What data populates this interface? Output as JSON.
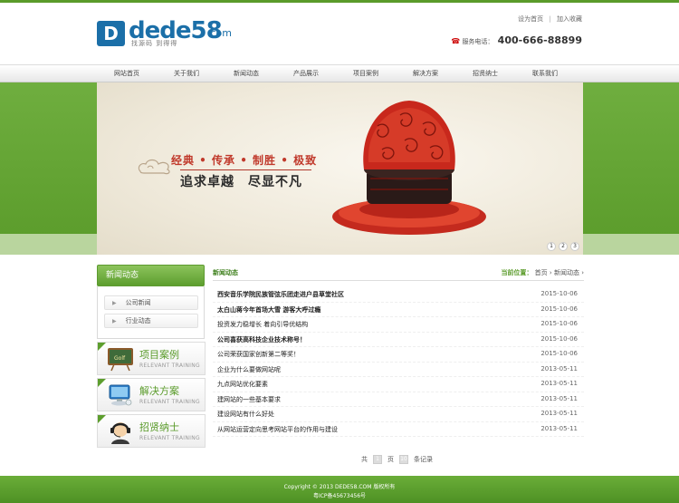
{
  "header": {
    "logo_mark": "D",
    "logo_text": "dede58",
    "logo_com": ".com",
    "logo_sub": "找源码 到得得",
    "links": [
      "设为首页",
      "加入收藏"
    ],
    "hotline_label": "服务电话：",
    "hotline_number": "400-666-88899"
  },
  "nav": [
    "网站首页",
    "关于我们",
    "新闻动态",
    "产品展示",
    "项目案例",
    "解决方案",
    "招贤纳士",
    "联系我们"
  ],
  "banner": {
    "slogan1": "经典 • 传承 • 制胜 • 极致",
    "slogan2": "追求卓越　尽显不凡",
    "dots": [
      "1",
      "2",
      "3"
    ]
  },
  "sidebar": {
    "title": "新闻动态",
    "links": [
      "公司新闻",
      "行业动态"
    ],
    "promos": [
      {
        "title": "项目案例",
        "sub": "RELEVANT TRAINING",
        "icon": "chalkboard-icon"
      },
      {
        "title": "解决方案",
        "sub": "RELEVANT TRAINING",
        "icon": "computer-icon"
      },
      {
        "title": "招贤纳士",
        "sub": "RELEVANT TRAINING",
        "icon": "support-agent-icon"
      }
    ]
  },
  "main": {
    "title": "新闻动态",
    "crumb_label": "当前位置：",
    "crumb_home": "首页",
    "crumb_current": "新闻动态",
    "news": [
      {
        "title": "西安音乐学院民族管弦乐团走进户县草堂社区",
        "date": "2015-10-06",
        "bold": true
      },
      {
        "title": "太白山蒋今年首场大雪 游客大呼过瘾",
        "date": "2015-10-06",
        "bold": true
      },
      {
        "title": "投资发力稳增长 着向引导优结构",
        "date": "2015-10-06",
        "bold": false
      },
      {
        "title": "公司喜获高科技企业技术称号！",
        "date": "2015-10-06",
        "bold": true
      },
      {
        "title": "公司荣获国家创新第二等奖！",
        "date": "2015-10-06",
        "bold": false
      },
      {
        "title": "企业为什么要做网站呢",
        "date": "2013-05-11",
        "bold": false
      },
      {
        "title": "九点网站优化要素",
        "date": "2013-05-11",
        "bold": false
      },
      {
        "title": "建网站的一些基本要求",
        "date": "2013-05-11",
        "bold": false
      },
      {
        "title": "建设网站有什么好处",
        "date": "2013-05-11",
        "bold": false
      },
      {
        "title": "从网站运营定向思考网站平台的作用与建设",
        "date": "2013-05-11",
        "bold": false
      }
    ],
    "pager": {
      "total_prefix": "共",
      "pages": "1",
      "pages_suffix": "页",
      "records": "10",
      "records_suffix": "条记录"
    }
  },
  "footer": {
    "line1": "Copyright © 2013 DEDE58.COM 版权所有",
    "line2": "粤ICP备45673456号"
  },
  "colors": {
    "brand_green": "#5a9b2a",
    "logo_blue": "#1b6fa8",
    "accent_red": "#c0392b"
  }
}
